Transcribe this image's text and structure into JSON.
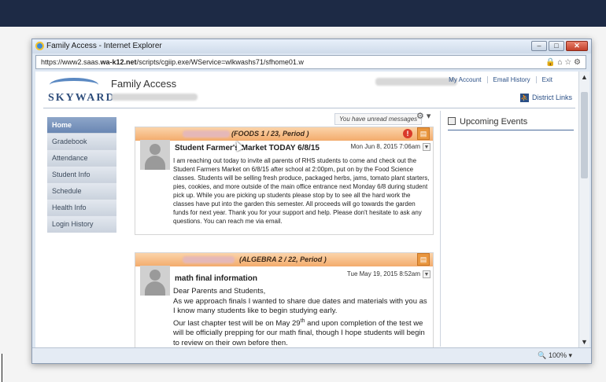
{
  "window": {
    "title": "Family Access - Internet Explorer",
    "url_prefix": "https://www2.saas.",
    "url_host": "wa-k12.net",
    "url_path": "/scripts/cgiip.exe/WService=wlkwashs71/sfhome01.w",
    "min": "–",
    "max": "□",
    "close": "✕",
    "zoom": "100%"
  },
  "header": {
    "logo": "SKYWARD",
    "title": "Family Access",
    "links": [
      "My Account",
      "Email History",
      "Exit"
    ],
    "district_links": "District Links"
  },
  "sidebar": {
    "items": [
      {
        "label": "Home",
        "active": true
      },
      {
        "label": "Gradebook"
      },
      {
        "label": "Attendance"
      },
      {
        "label": "Student Info"
      },
      {
        "label": "Schedule"
      },
      {
        "label": "Health Info"
      },
      {
        "label": "Login History"
      }
    ]
  },
  "toolbar": {
    "unread": "You have unread messages"
  },
  "events": {
    "title": "Upcoming Events"
  },
  "messages": [
    {
      "course": "(FOODS 1 / 23, Period )",
      "subject": "Student Farmer's Market TODAY 6/8/15",
      "date": "Mon Jun 8, 2015 7:06am",
      "body": "I am reaching out today to invite all parents of RHS students to come and check out the Student  Farmers Market on 6/8/15 after school at 2:00pm, put on by the Food Science classes. Students will be selling fresh produce, packaged herbs, jams, tomato plant starters, pies, cookies, and more outside of the main office entrance next Monday 6/8 during student pick up.  While you are picking up students please stop by to see all the hard work the classes have put into the garden this semester. All proceeds will go towards the garden funds for next year. Thank you for your support and help. Please don't hesitate to ask any questions. You can reach me via email."
    },
    {
      "course": "(ALGEBRA 2 / 22, Period )",
      "subject": "math final information",
      "date": "Tue May 19, 2015 8:52am",
      "greeting": "Dear Parents and Students,",
      "para1": "As we approach finals I wanted to share due dates and materials with you as I know many students like to begin studying early.",
      "para2_a": "Our last chapter test will be on May 29",
      "para2_sup": "th",
      "para2_b": "and upon completion of the test we will be officially prepping for our math final, though I hope students will begin to review on their own before then."
    }
  ]
}
